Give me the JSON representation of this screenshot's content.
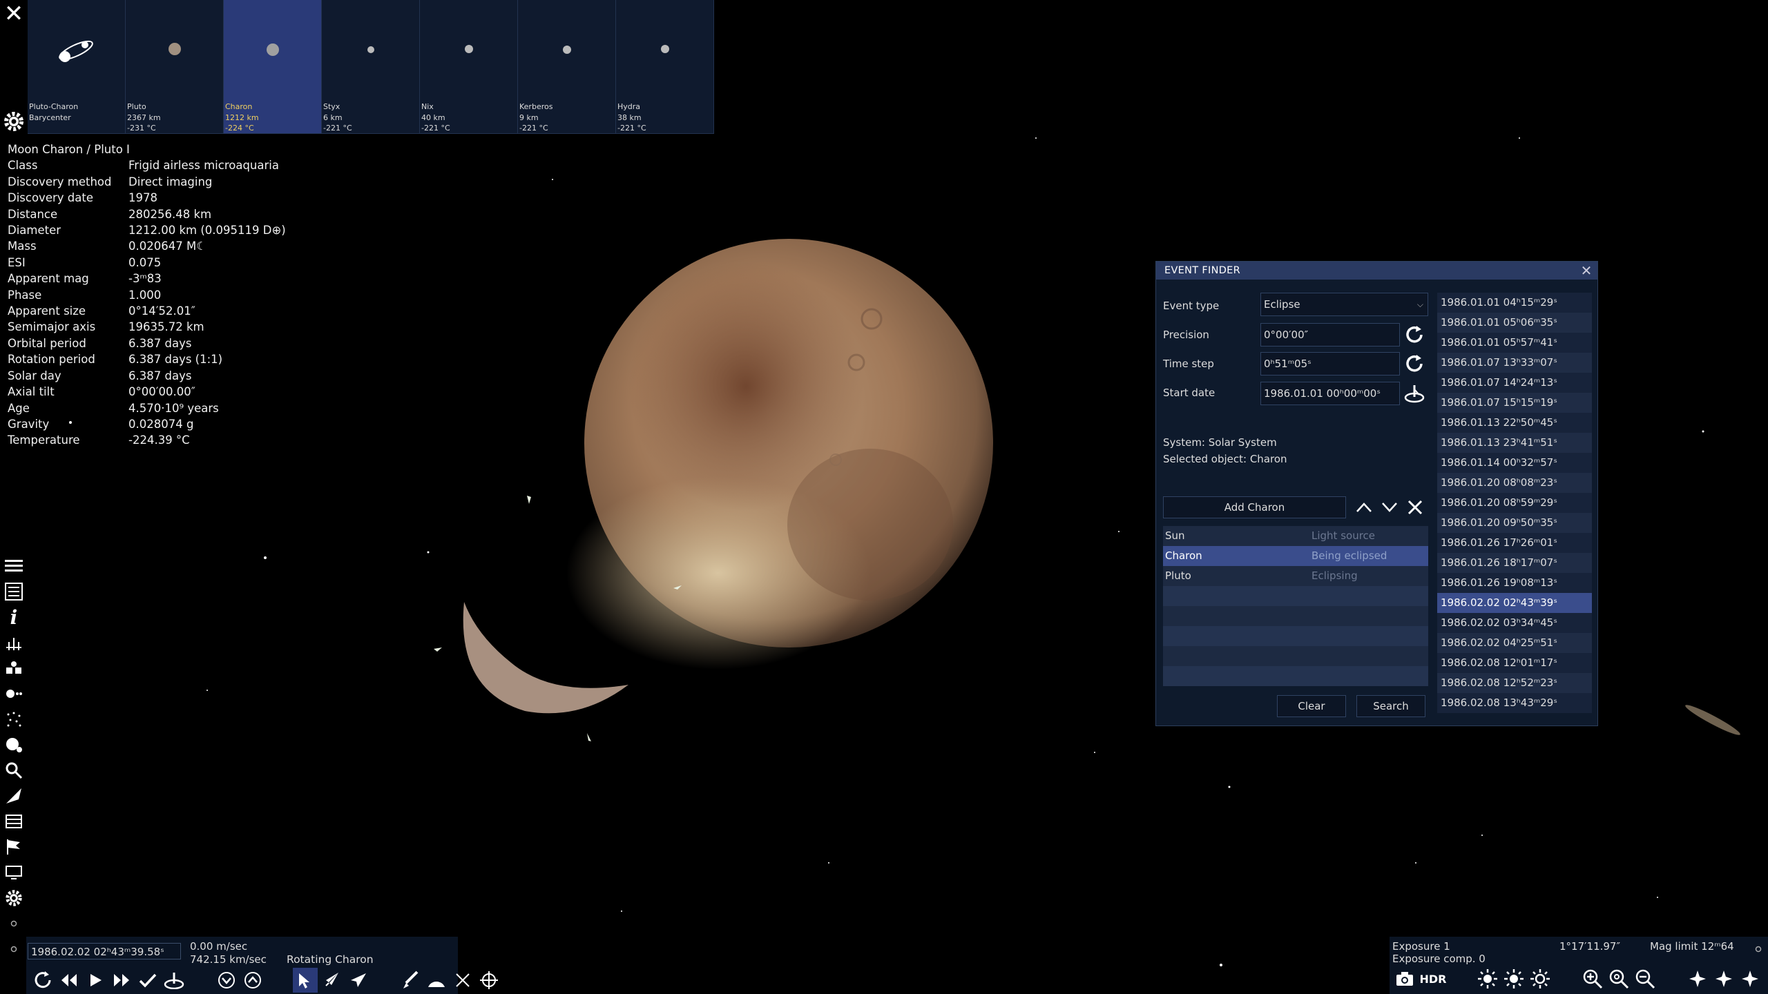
{
  "strip": {
    "tiles": [
      {
        "name": "Pluto-Charon",
        "size": "Barycenter",
        "temp": "",
        "selected": false
      },
      {
        "name": "Pluto",
        "size": "2367 km",
        "temp": "-231 °C",
        "selected": false
      },
      {
        "name": "Charon",
        "size": "1212 km",
        "temp": "-224 °C",
        "selected": true
      },
      {
        "name": "Styx",
        "size": "6 km",
        "temp": "-221 °C",
        "selected": false
      },
      {
        "name": "Nix",
        "size": "40 km",
        "temp": "-221 °C",
        "selected": false
      },
      {
        "name": "Kerberos",
        "size": "9 km",
        "temp": "-221 °C",
        "selected": false
      },
      {
        "name": "Hydra",
        "size": "38 km",
        "temp": "-221 °C",
        "selected": false
      }
    ],
    "close_icon": "close-icon",
    "settings_icon": "gear-icon"
  },
  "info": {
    "heading": "Moon  Charon / Pluto I",
    "rows": [
      {
        "k": "Class",
        "v": "Frigid airless microaquaria"
      },
      {
        "k": "Discovery method",
        "v": "Direct imaging"
      },
      {
        "k": "Discovery date",
        "v": "1978"
      },
      {
        "k": "Distance",
        "v": "280256.48 km"
      },
      {
        "k": "Diameter",
        "v": "1212.00 km (0.095119 D⊕)"
      },
      {
        "k": "Mass",
        "v": "0.020647 M☾"
      },
      {
        "k": "ESI",
        "v": "0.075"
      },
      {
        "k": "Apparent mag",
        "v": "-3ᵐ83"
      },
      {
        "k": "Phase",
        "v": "1.000"
      },
      {
        "k": "Apparent size",
        "v": "0°14′52.01″"
      },
      {
        "k": "Semimajor axis",
        "v": "19635.72 km"
      },
      {
        "k": "Orbital period",
        "v": "6.387 days"
      },
      {
        "k": "Rotation period",
        "v": "6.387 days (1:1)"
      },
      {
        "k": "Solar day",
        "v": "6.387 days"
      },
      {
        "k": "Axial tilt",
        "v": "0°00′00.00″"
      },
      {
        "k": "Age",
        "v": "4.570·10⁹ years"
      },
      {
        "k": "Gravity",
        "v": "0.028074 g"
      },
      {
        "k": "Temperature",
        "v": "-224.39 °C"
      }
    ]
  },
  "event_finder": {
    "title": "EVENT FINDER",
    "event_type_label": "Event type",
    "event_type_value": "Eclipse",
    "precision_label": "Precision",
    "precision_value": "0°00′00″",
    "time_step_label": "Time step",
    "time_step_value": "0ʰ51ᵐ05ˢ",
    "start_date_label": "Start date",
    "start_date_value": "1986.01.01 00ʰ00ᵐ00ˢ",
    "system_text": "System: Solar System",
    "selected_text": "Selected object: Charon",
    "add_button": "Add Charon",
    "objects": [
      {
        "name": "Sun",
        "role": "Light source",
        "selected": false
      },
      {
        "name": "Charon",
        "role": "Being eclipsed",
        "selected": true
      },
      {
        "name": "Pluto",
        "role": "Eclipsing",
        "selected": false
      },
      {
        "name": "",
        "role": "",
        "selected": false
      },
      {
        "name": "",
        "role": "",
        "selected": false
      },
      {
        "name": "",
        "role": "",
        "selected": false
      },
      {
        "name": "",
        "role": "",
        "selected": false
      },
      {
        "name": "",
        "role": "",
        "selected": false
      }
    ],
    "clear_button": "Clear",
    "search_button": "Search",
    "results": [
      "1986.01.01 04ʰ15ᵐ29ˢ",
      "1986.01.01 05ʰ06ᵐ35ˢ",
      "1986.01.01 05ʰ57ᵐ41ˢ",
      "1986.01.07 13ʰ33ᵐ07ˢ",
      "1986.01.07 14ʰ24ᵐ13ˢ",
      "1986.01.07 15ʰ15ᵐ19ˢ",
      "1986.01.13 22ʰ50ᵐ45ˢ",
      "1986.01.13 23ʰ41ᵐ51ˢ",
      "1986.01.14 00ʰ32ᵐ57ˢ",
      "1986.01.20 08ʰ08ᵐ23ˢ",
      "1986.01.20 08ʰ59ᵐ29ˢ",
      "1986.01.20 09ʰ50ᵐ35ˢ",
      "1986.01.26 17ʰ26ᵐ01ˢ",
      "1986.01.26 18ʰ17ᵐ07ˢ",
      "1986.01.26 19ʰ08ᵐ13ˢ",
      "1986.02.02 02ʰ43ᵐ39ˢ",
      "1986.02.02 03ʰ34ᵐ45ˢ",
      "1986.02.02 04ʰ25ᵐ51ˢ",
      "1986.02.08 12ʰ01ᵐ17ˢ",
      "1986.02.08 12ʰ52ᵐ23ˢ",
      "1986.02.08 13ʰ43ᵐ29ˢ"
    ],
    "selected_result_index": 15
  },
  "bottom_left": {
    "date": "1986.02.02 02ʰ43ᵐ39.58ˢ",
    "speed1": "0.00 m/sec",
    "speed2": "742.15 km/sec",
    "mode": "Rotating Charon"
  },
  "bottom_right": {
    "exposure": "Exposure 1",
    "exposure_comp": "Exposure comp. 0",
    "fov": "1°17′11.97″",
    "mag_limit": "Mag limit 12ᵐ64",
    "hdr_label": "HDR"
  },
  "colors": {
    "panel_bg": "#0e1a2c",
    "title_bg": "#2a3a62",
    "selection": "#3a4d8c",
    "tile_selected": "#2a3a78",
    "highlight_text": "#f0d060"
  }
}
